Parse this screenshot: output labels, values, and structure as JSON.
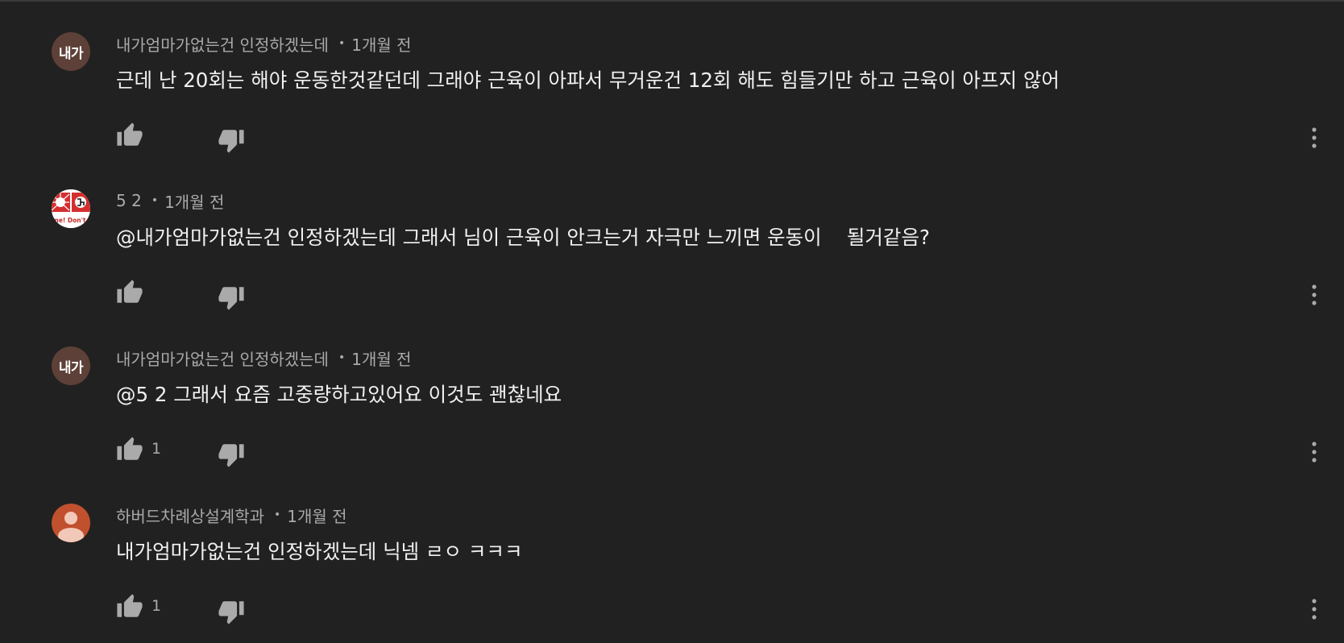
{
  "comments": [
    {
      "avatar_text": "내가",
      "avatar_color": "#5d4037",
      "author": "내가엄마가없는건 인정하겠는데",
      "separator": "•",
      "time": "1개월 전",
      "text": "근데 난 20회는 해야 운동한것같던데 그래야 근육이 아파서 무거운건 12회 해도 힘들기만 하고 근육이 아프지 않어",
      "like_count": ""
    },
    {
      "avatar_text": "",
      "avatar_caption": "me! Don't u",
      "avatar_color": "#ffffff",
      "author": "5 2",
      "separator": "•",
      "time": "1개월 전",
      "text": "@내가엄마가없는건 인정하겠는데 그래서 님이 근육이 안크는거 자극만 느끼면 운동이    될거같음?",
      "like_count": ""
    },
    {
      "avatar_text": "내가",
      "avatar_color": "#5d4037",
      "author": "내가엄마가없는건 인정하겠는데",
      "separator": "•",
      "time": "1개월 전",
      "text": "@5 2 그래서 요즘 고중량하고있어요 이것도 괜찮네요",
      "like_count": "1"
    },
    {
      "avatar_text": "",
      "avatar_color": "#c1502e",
      "author": "하버드차례상설계학과",
      "separator": "•",
      "time": "1개월 전",
      "text": "내가엄마가없는건 인정하겠는데 닉넴 ㄹㅇ ㅋㅋㅋ",
      "like_count": "1"
    }
  ],
  "icons": {
    "like": "thumbs-up-icon",
    "dislike": "thumbs-down-icon",
    "more": "more-vertical-icon"
  },
  "colors": {
    "background": "#212121",
    "author_text": "#aaaaaa",
    "body_text": "#f1f1f1",
    "icon": "#aaaaaa"
  }
}
